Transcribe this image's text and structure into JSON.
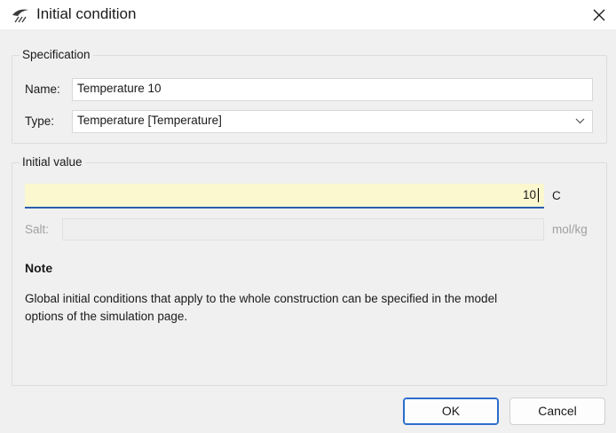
{
  "window": {
    "title": "Initial condition",
    "icon": "wave-icon",
    "close_icon": "close-icon"
  },
  "specification": {
    "legend": "Specification",
    "name_label": "Name:",
    "name_value": "Temperature 10",
    "type_label": "Type:",
    "type_value": "Temperature [Temperature]"
  },
  "initial_value": {
    "legend": "Initial value",
    "value": "10",
    "unit": "C",
    "salt_label": "Salt:",
    "salt_value": "",
    "salt_unit": "mol/kg"
  },
  "note": {
    "title": "Note",
    "line1": "Global initial conditions that apply to the whole construction can be specified in the model",
    "line2": "options of the simulation page."
  },
  "buttons": {
    "ok": "OK",
    "cancel": "Cancel"
  },
  "colors": {
    "accent": "#2b5eb0",
    "input_highlight": "#fbf7cf"
  }
}
